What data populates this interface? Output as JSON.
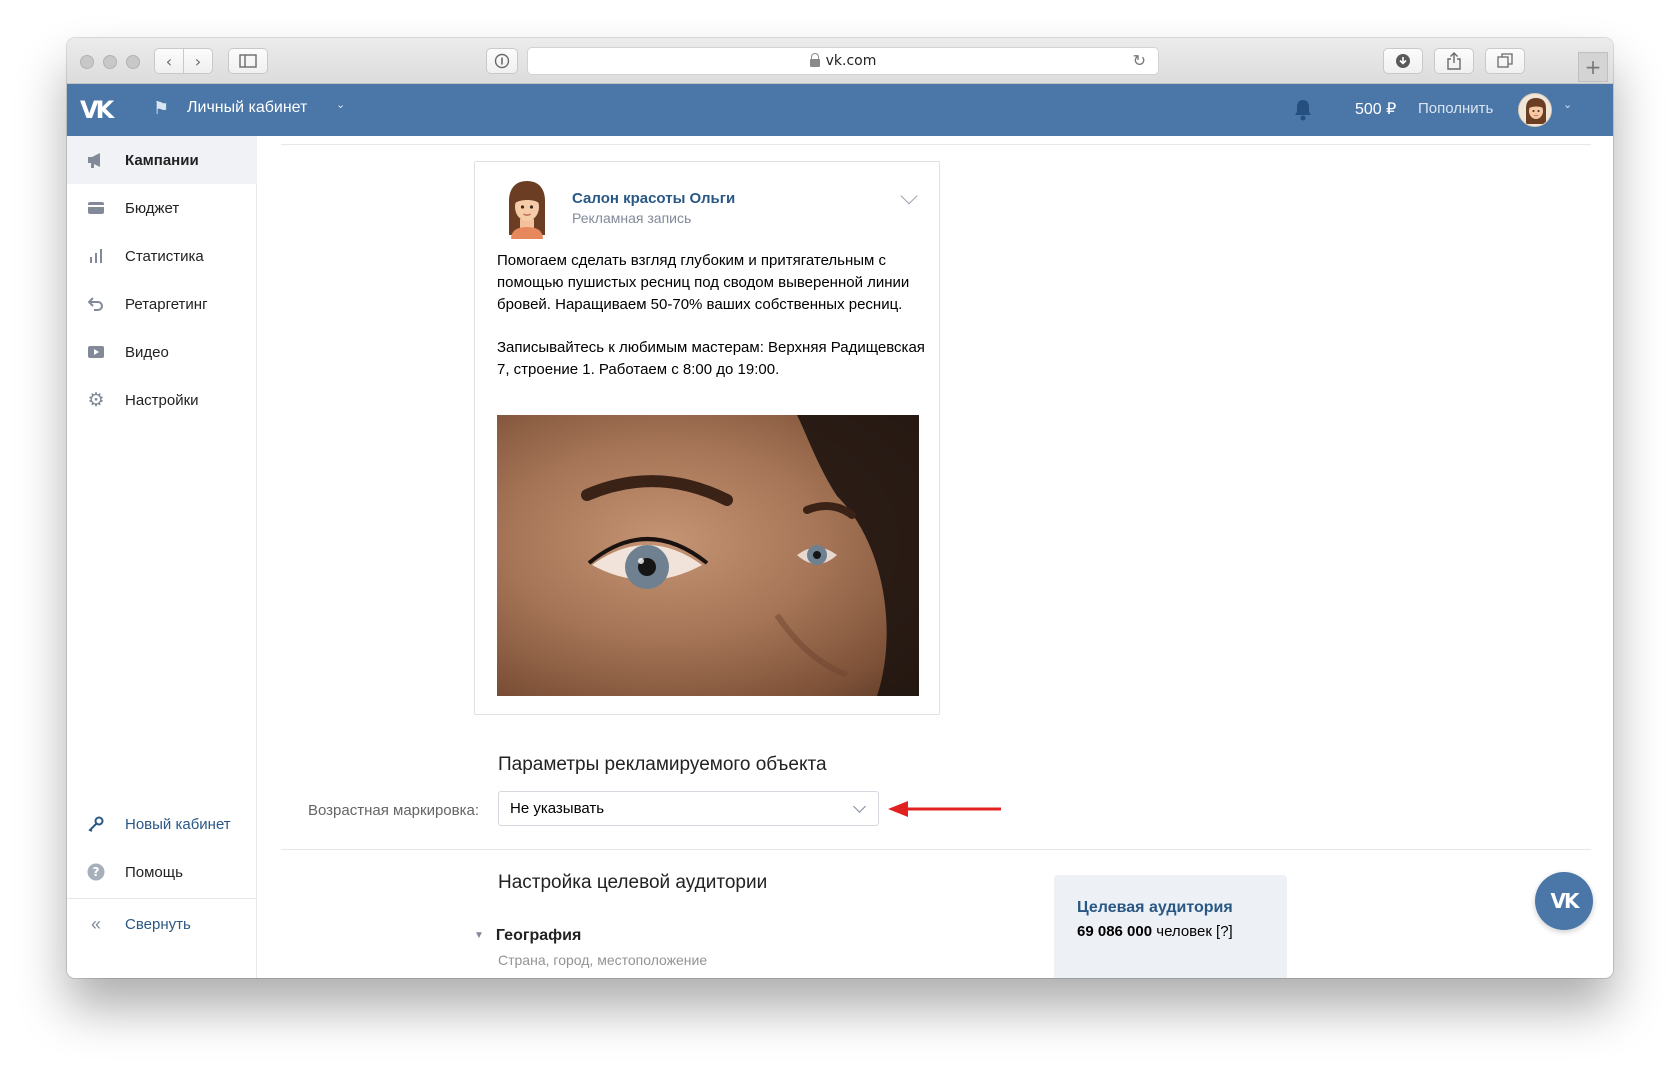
{
  "browser": {
    "url": "vk.com",
    "buttons": {
      "back": "‹",
      "forward": "›"
    }
  },
  "header": {
    "section_title": "Личный кабинет",
    "balance": "500 ₽",
    "topup_label": "Пополнить"
  },
  "sidebar": {
    "items": [
      {
        "label": "Кампании",
        "icon": "megaphone-icon"
      },
      {
        "label": "Бюджет",
        "icon": "wallet-icon"
      },
      {
        "label": "Статистика",
        "icon": "bar-chart-icon"
      },
      {
        "label": "Ретаргетинг",
        "icon": "retarget-icon"
      },
      {
        "label": "Видео",
        "icon": "video-icon"
      },
      {
        "label": "Настройки",
        "icon": "gear-icon"
      }
    ],
    "new_cabinet": "Новый кабинет",
    "help": "Помощь",
    "collapse": "Свернуть"
  },
  "post": {
    "author": "Салон красоты Ольги",
    "subtitle": "Рекламная запись",
    "paragraph1": "Помогаем сделать взгляд глубоким и притягательным с помощью пушистых ресниц под сводом выверенной линии бровей. Наращиваем 50-70% ваших собственных ресниц.",
    "paragraph2": "Записывайтесь к любимым мастерам: Верхняя Радищевская 7, строение 1. Работаем с 8:00 до 19:00."
  },
  "params": {
    "title": "Параметры рекламируемого объекта",
    "age_label": "Возрастная маркировка:",
    "age_value": "Не указывать"
  },
  "audience": {
    "title": "Настройка целевой аудитории",
    "geo_label": "География",
    "geo_sub": "Страна, город, местоположение",
    "box_title": "Целевая аудитория",
    "box_count": "69 086 000",
    "box_unit": "человек [?]"
  },
  "colors": {
    "brand": "#4a76a8",
    "link": "#2a5885",
    "arrow": "#e1201f"
  }
}
